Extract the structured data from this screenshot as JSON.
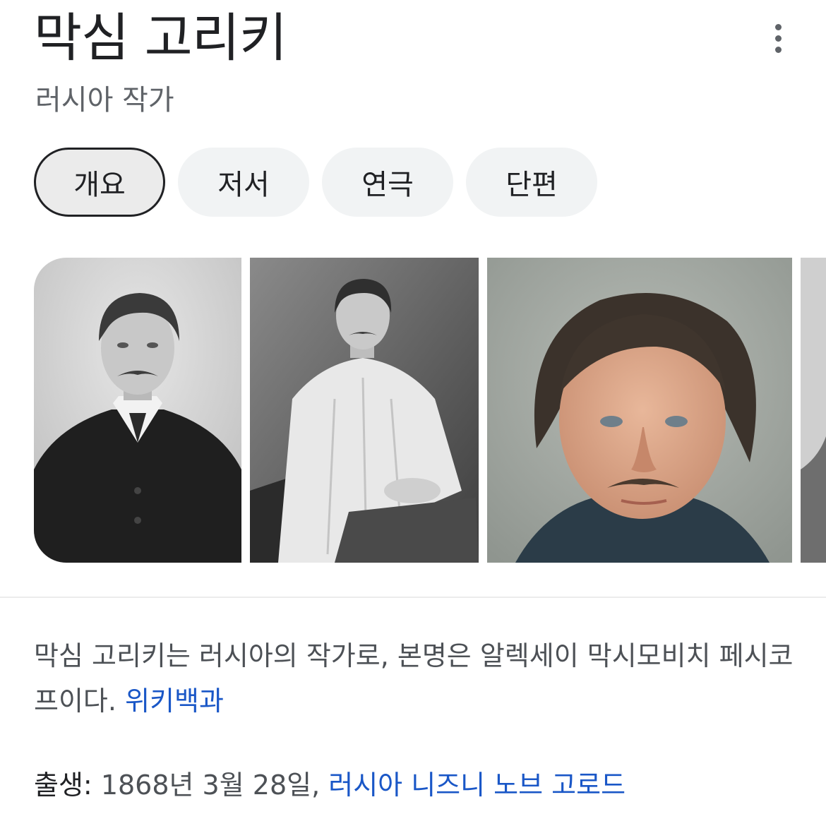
{
  "header": {
    "title": "막심 고리키",
    "subtitle": "러시아 작가",
    "more_icon": "more-vert-icon"
  },
  "tabs": [
    {
      "label": "개요",
      "selected": true
    },
    {
      "label": "저서",
      "selected": false
    },
    {
      "label": "연극",
      "selected": false
    },
    {
      "label": "단편",
      "selected": false
    }
  ],
  "gallery": {
    "images": [
      {
        "description": "black-and-white portrait, dark suit and high collar"
      },
      {
        "description": "black-and-white seated portrait, light shirt"
      },
      {
        "description": "colorized portrait close-up"
      },
      {
        "description": "partially visible photo"
      }
    ]
  },
  "description": {
    "text": "막심 고리키는 러시아의 작가로, 본명은 알렉세이 막시모비치 페시코프이다.",
    "source_link": "위키백과"
  },
  "facts": {
    "born": {
      "label": "출생",
      "separator": ": ",
      "date": "1868년 3월 28일, ",
      "place_link": "러시아 니즈니 노브 고로드"
    }
  },
  "colors": {
    "text_primary": "#202124",
    "text_secondary": "#4d5156",
    "link": "#1a57c7",
    "chip_bg": "#f1f3f4"
  }
}
